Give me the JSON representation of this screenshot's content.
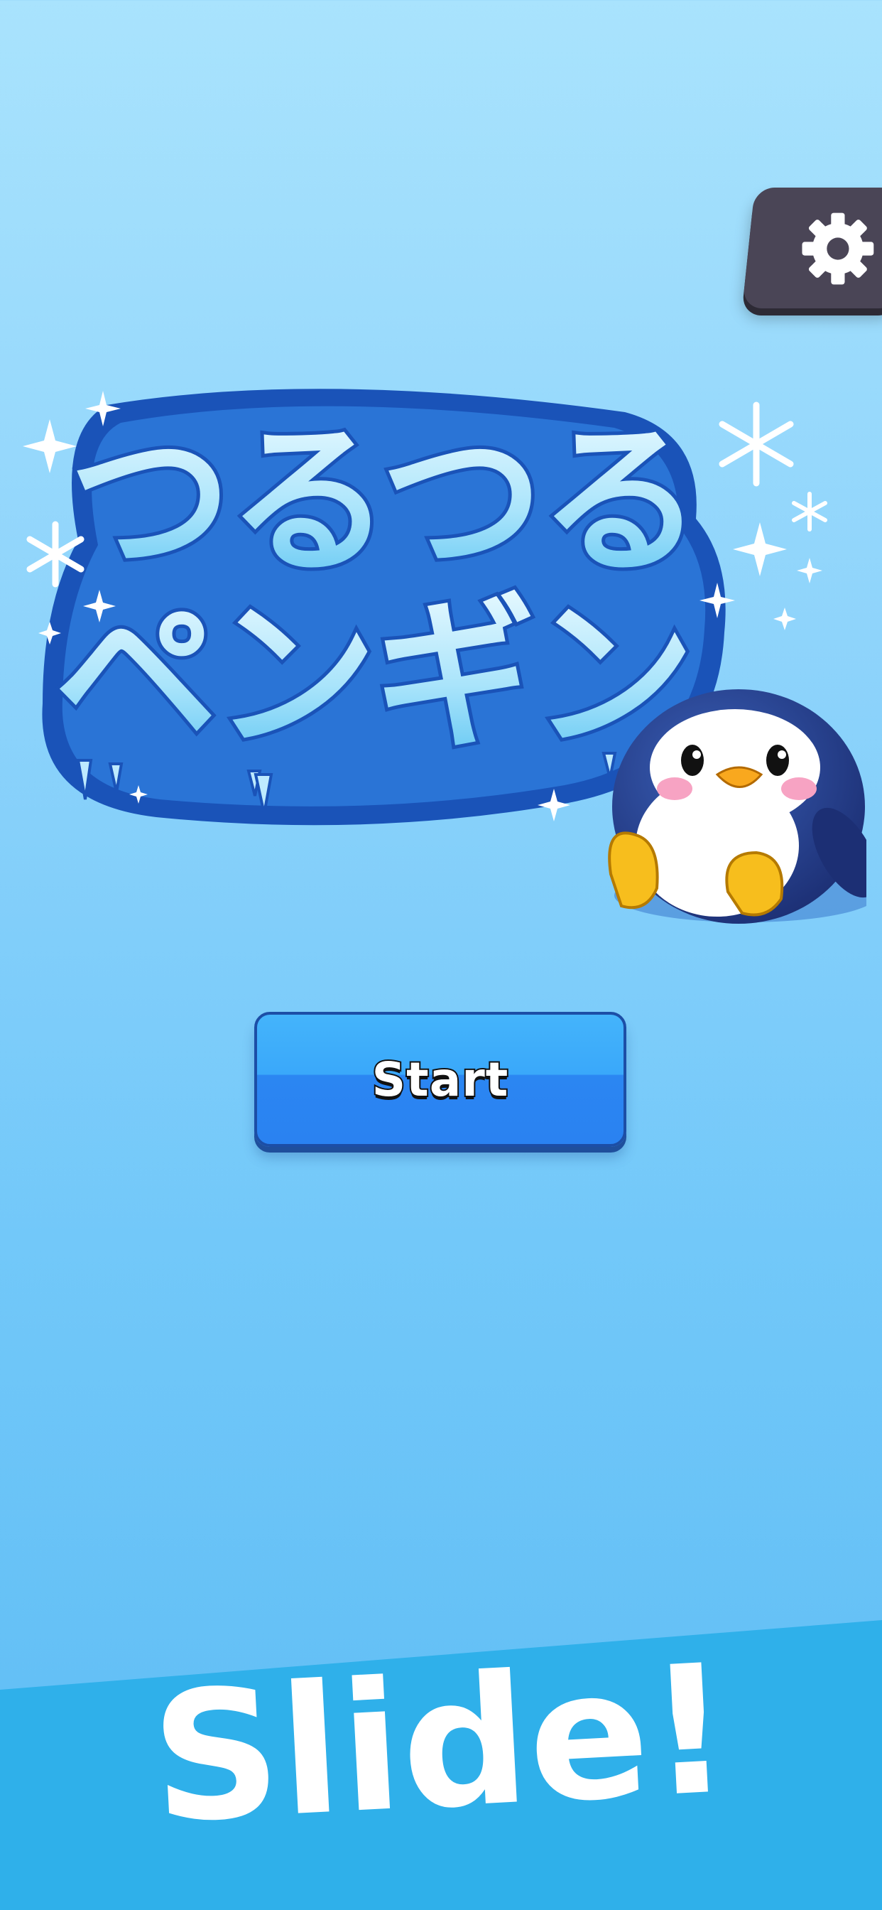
{
  "settings": {
    "icon": "gear-icon"
  },
  "logo": {
    "line1": "つるつる",
    "line2": "ペンギン",
    "mascot": "penguin"
  },
  "start_button": {
    "label": "Start"
  },
  "banner": {
    "text": "Slide!"
  },
  "colors": {
    "sky_top": "#a9e3fd",
    "sky_bottom": "#5dbcf4",
    "button_blue": "#2a82f1",
    "banner_blue": "#2fb0ea",
    "settings_tab": "#4a4556"
  }
}
